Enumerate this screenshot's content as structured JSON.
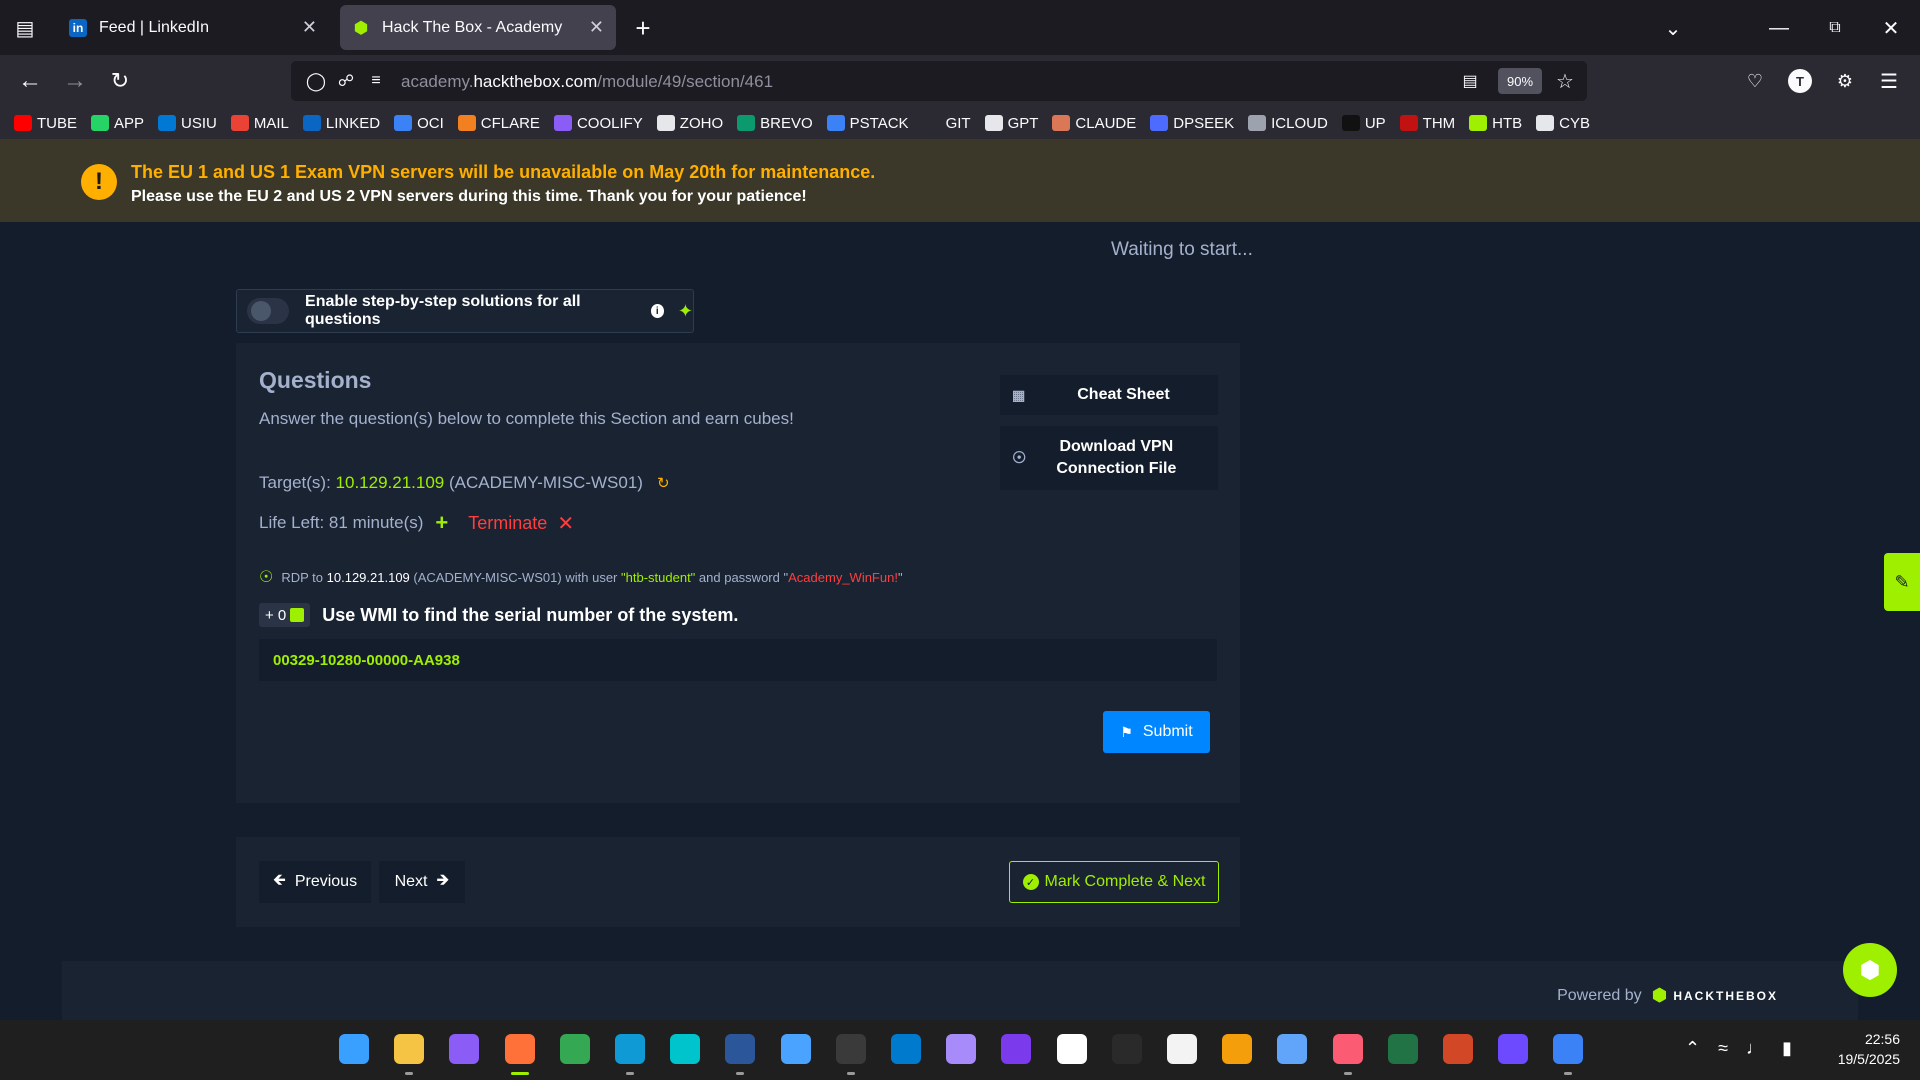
{
  "browser": {
    "tabs": [
      {
        "title": "Feed | LinkedIn",
        "active": false
      },
      {
        "title": "Hack The Box - Academy",
        "active": true
      }
    ],
    "url_prefix": "academy.",
    "url_domain": "hackthebox.com",
    "url_path": "/module/49/section/461",
    "zoom": "90%",
    "bookmarks": [
      {
        "label": "TUBE",
        "color": "#ff0000"
      },
      {
        "label": "APP",
        "color": "#25d366"
      },
      {
        "label": "USIU",
        "color": "#0078d4"
      },
      {
        "label": "MAIL",
        "color": "#ea4335"
      },
      {
        "label": "LINKED",
        "color": "#0a66c2"
      },
      {
        "label": "OCI",
        "color": "#3b82f6"
      },
      {
        "label": "CFLARE",
        "color": "#f38020"
      },
      {
        "label": "COOLIFY",
        "color": "#8b5cf6"
      },
      {
        "label": "ZOHO",
        "color": "#e5e7eb"
      },
      {
        "label": "BREVO",
        "color": "#0b996e"
      },
      {
        "label": "PSTACK",
        "color": "#3b82f6"
      },
      {
        "label": "GIT",
        "color": "#2b2a33"
      },
      {
        "label": "GPT",
        "color": "#e5e7eb"
      },
      {
        "label": "CLAUDE",
        "color": "#d97757"
      },
      {
        "label": "DPSEEK",
        "color": "#4d6bfe"
      },
      {
        "label": "ICLOUD",
        "color": "#9ca3af"
      },
      {
        "label": "UP",
        "color": "#111111"
      },
      {
        "label": "THM",
        "color": "#c11111"
      },
      {
        "label": "HTB",
        "color": "#9fef00"
      },
      {
        "label": "CYB",
        "color": "#e5e7eb"
      }
    ]
  },
  "banner": {
    "title": "The EU 1 and US 1 Exam VPN servers will be unavailable on May 20th for maintenance.",
    "subtitle": "Please use the EU 2 and US 2 VPN servers during this time. Thank you for your patience!"
  },
  "status": "Waiting to start...",
  "toggle": {
    "label": "Enable step-by-step solutions for all questions"
  },
  "questions": {
    "title": "Questions",
    "description": "Answer the question(s) below to complete this Section and earn cubes!",
    "target_label": "Target(s):",
    "target_ip": "10.129.21.109",
    "target_name": "(ACADEMY-MISC-WS01)",
    "life_label": "Life Left: 81 minute(s)",
    "terminate": "Terminate",
    "cheat_sheet": "Cheat Sheet",
    "vpn_line1": "Download VPN",
    "vpn_line2": "Connection File",
    "rdp": {
      "prefix": "RDP to",
      "ip": "10.129.21.109",
      "host": "(ACADEMY-MISC-WS01)",
      "with_user": "with user",
      "user": "\"htb-student\"",
      "and_password": "and password",
      "password_q1": "\"",
      "password": "Academy_WinFun!",
      "password_q2": "\""
    },
    "cube_badge": "+ 0",
    "question": "Use WMI to find the serial number of the system.",
    "answer": "00329-10280-00000-AA938",
    "submit": "Submit"
  },
  "navigation": {
    "previous": "Previous",
    "next": "Next",
    "mark_complete": "Mark Complete & Next"
  },
  "footer": {
    "powered_by": "Powered by",
    "brand": "HACKTHEBOX"
  },
  "taskbar": {
    "time": "22:56",
    "date": "19/5/2025",
    "apps": [
      {
        "name": "start",
        "color": "#3aa0ff"
      },
      {
        "name": "file-explorer",
        "color": "#f6c445"
      },
      {
        "name": "app-mask",
        "color": "#8b5cf6"
      },
      {
        "name": "firefox",
        "color": "#ff7139"
      },
      {
        "name": "chrome",
        "color": "#34a853"
      },
      {
        "name": "edge",
        "color": "#0f9ad5"
      },
      {
        "name": "canva",
        "color": "#00c4cc"
      },
      {
        "name": "word",
        "color": "#2b579a"
      },
      {
        "name": "notepad",
        "color": "#4aa3ff"
      },
      {
        "name": "terminal",
        "color": "#3a3a3a"
      },
      {
        "name": "vscode",
        "color": "#007acc"
      },
      {
        "name": "app-purple",
        "color": "#a78bfa"
      },
      {
        "name": "obsidian",
        "color": "#7c3aed"
      },
      {
        "name": "capcut",
        "color": "#ffffff"
      },
      {
        "name": "obs",
        "color": "#2a2a2a"
      },
      {
        "name": "store",
        "color": "#f3f3f3"
      },
      {
        "name": "todo",
        "color": "#f59e0b"
      },
      {
        "name": "mail",
        "color": "#60a5fa"
      },
      {
        "name": "itunes",
        "color": "#fb5c74"
      },
      {
        "name": "excel",
        "color": "#217346"
      },
      {
        "name": "powerpoint",
        "color": "#d24726"
      },
      {
        "name": "proton-vpn",
        "color": "#6d4aff"
      },
      {
        "name": "kali",
        "color": "#3b82f6"
      }
    ]
  }
}
